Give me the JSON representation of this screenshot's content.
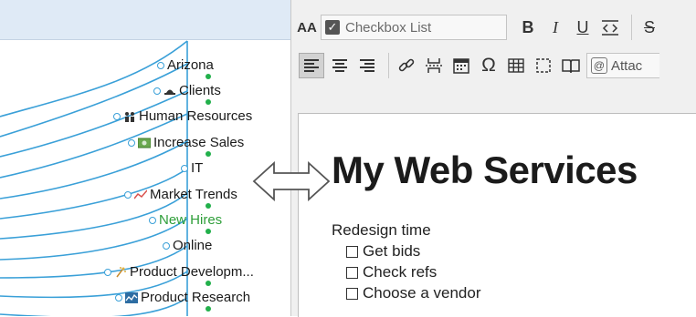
{
  "mindmap": {
    "nodes": [
      {
        "label": "Arizona",
        "icon": "none"
      },
      {
        "label": "Clients",
        "icon": "hat-icon"
      },
      {
        "label": "Human Resources",
        "icon": "people-icon"
      },
      {
        "label": "Increase Sales",
        "icon": "money-icon"
      },
      {
        "label": "IT",
        "icon": "none"
      },
      {
        "label": "Market Trends",
        "icon": "trend-icon"
      },
      {
        "label": "New Hires",
        "icon": "none",
        "highlighted": true
      },
      {
        "label": "Online",
        "icon": "none"
      },
      {
        "label": "Product Developm...",
        "icon": "sparkle-icon"
      },
      {
        "label": "Product Research",
        "icon": "chart-icon"
      }
    ],
    "line_color": "#3aa0d8",
    "dot_color": "#22b04b",
    "highlight_color": "#2e9e39"
  },
  "toolbar": {
    "font_size_glyph": "AA",
    "style_label": "Checkbox List",
    "bold": "B",
    "italic": "I",
    "underline": "U",
    "strike": "S",
    "omega": "Ω",
    "attach_label": "Attac"
  },
  "document": {
    "title": "My Web Services",
    "subtitle": "Redesign time",
    "items": [
      "Get bids",
      "Check refs",
      "Choose a vendor"
    ]
  }
}
